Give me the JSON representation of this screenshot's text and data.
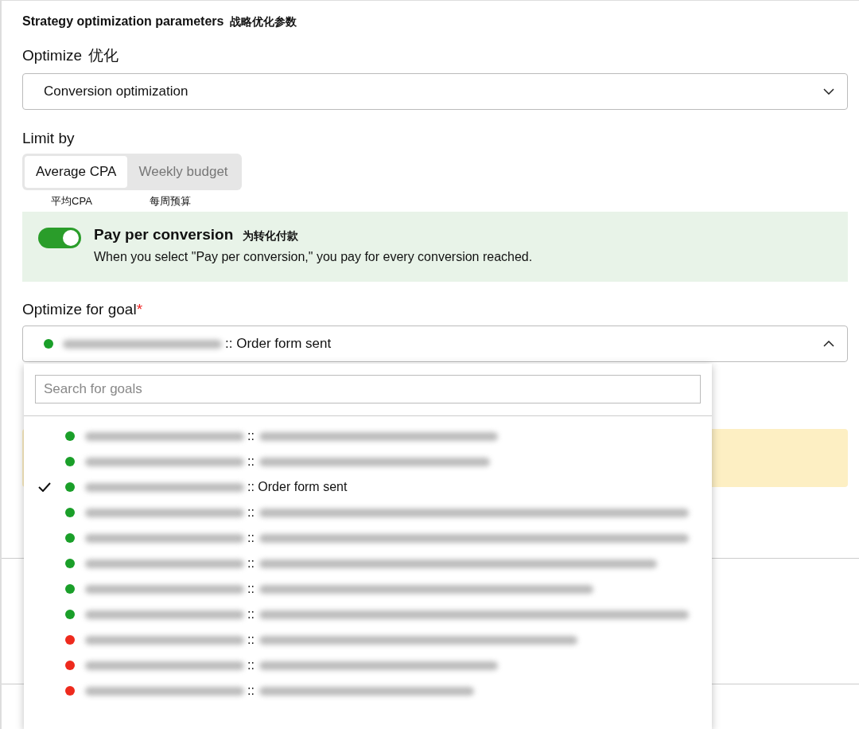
{
  "section_title": {
    "text": "Strategy optimization parameters",
    "note": "战略优化参数"
  },
  "optimize": {
    "label": "Optimize",
    "note": "优化",
    "value": "Conversion optimization"
  },
  "limit_by": {
    "label": "Limit by",
    "options": [
      {
        "label": "Average CPA",
        "note": "平均CPA",
        "selected": true
      },
      {
        "label": "Weekly budget",
        "note": "每周预算",
        "selected": false
      }
    ]
  },
  "pay_per_conversion": {
    "on": true,
    "title": "Pay per conversion",
    "note": "为转化付款",
    "description": "When you select \"Pay per conversion,\" you pay for every conversion reached."
  },
  "goal": {
    "label": "Optimize for goal",
    "required_mark": "*",
    "value": ":: Order form sent",
    "color": "#1a9f29",
    "expanded": true
  },
  "goal_dropdown": {
    "search": {
      "placeholder": "Search for goals"
    },
    "items": [
      {
        "text": "::",
        "color": "#1a9f29",
        "selected": false
      },
      {
        "text": "::",
        "color": "#1a9f29",
        "selected": false
      },
      {
        "text": ":: Order form sent",
        "color": "#1a9f29",
        "selected": true
      },
      {
        "text": "::",
        "color": "#1a9f29",
        "selected": false
      },
      {
        "text": "::",
        "color": "#1a9f29",
        "selected": false
      },
      {
        "text": "::",
        "color": "#1a9f29",
        "selected": false
      },
      {
        "text": "::",
        "color": "#1a9f29",
        "selected": false
      },
      {
        "text": "::",
        "color": "#1a9f29",
        "selected": false
      },
      {
        "text": "::",
        "color": "#ee2a1d",
        "selected": false
      },
      {
        "text": "::",
        "color": "#ee2a1d",
        "selected": false
      },
      {
        "text": "::",
        "color": "#ee2a1d",
        "selected": false
      }
    ]
  }
}
